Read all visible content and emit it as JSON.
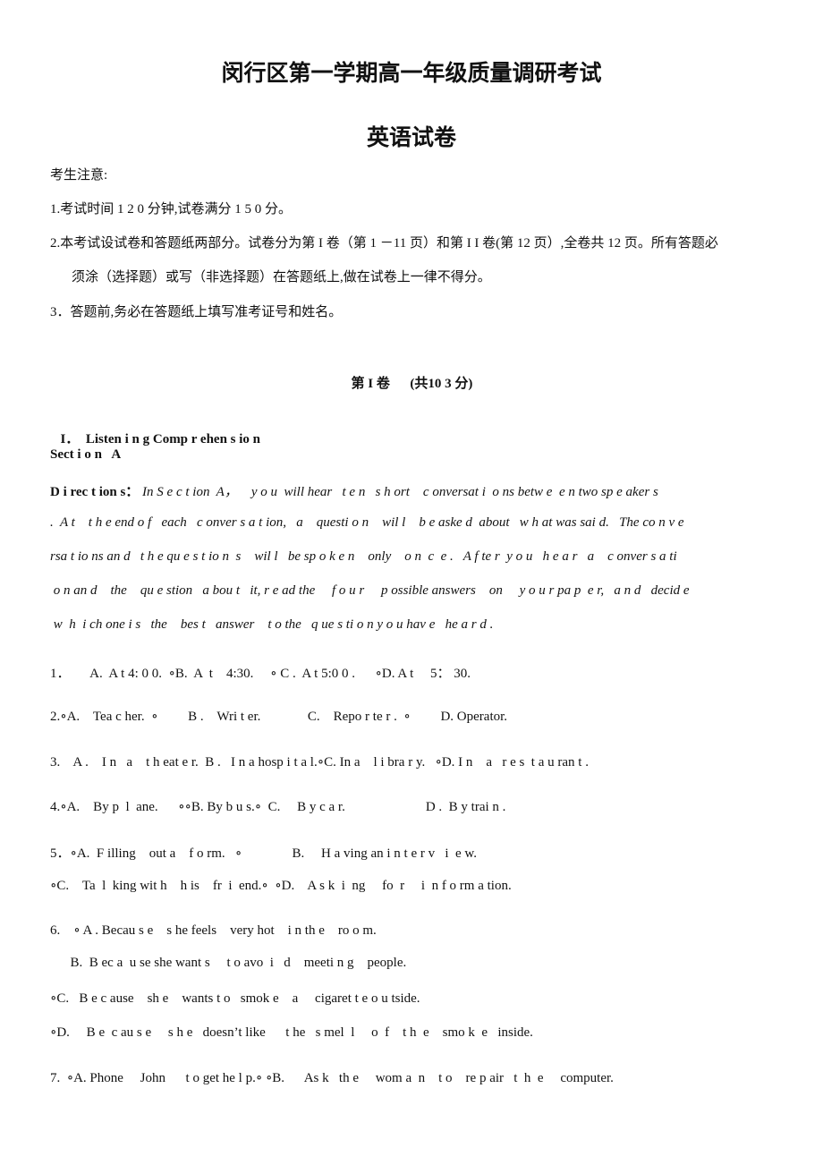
{
  "header": {
    "title": "闵行区第一学期高一年级质量调研考试",
    "subtitle": "英语试卷"
  },
  "notice": {
    "heading": "考生注意:",
    "items": [
      "1.考试时间 1 2 0 分钟,试卷满分 1 5 0 分。",
      "2.本考试设试卷和答题纸两部分。试卷分为第 I 卷（第 1 －11 页）和第 I I 卷(第 12 页）,全卷共 12 页。所有答题必",
      "须涂（选择题）或写（非选择题）在答题纸上,做在试卷上一律不得分。",
      "3．答题前,务必在答题纸上填写准考证号和姓名。"
    ]
  },
  "part": {
    "label": "第 I 卷",
    "score": "(共10 3 分)"
  },
  "section": {
    "roman": "I．",
    "title": "Listen i n g Comp r ehen s io n",
    "sub": "Sect i o n   A"
  },
  "directions": {
    "label": "D i rec t ion s：",
    "lines": [
      "In S e c t ion  A，    y o u  will hear   t e n   s h ort    c onversat i  o ns betw e  e n two sp e aker s",
      ".  A t    t h e end o f   each   c onver s a t ion,   a    questi o n    wil l    b e aske d  about   w h at was sai d.   The co n v e",
      "rsa t io ns an d   t h e qu e s t io n  s    wil l   be sp o k e n    only    o n  c  e .   A f te r  y o u   h e a r   a    c onver s a ti",
      " o n an d    the    qu e stion   a bou t   it, r e ad the     f o u r     p ossible answers    on     y o u r pa p  e r,   a n d   decid e",
      " w  h  i ch one i s   the    bes t   answer    t o the   q ue s ti o n y o u hav e   he a r d ."
    ]
  },
  "questions": [
    {
      "lines": [
        "1．      A.  A t 4: 0 0.  ∘B.  A  t    4:30.     ∘ C .  A t 5:0 0 .      ∘D. A t     5： 30."
      ]
    },
    {
      "lines": [
        "2.∘A.    Tea c her.  ∘         B .    Wri t er.              C.    Repo r te r .  ∘         D. Operator."
      ]
    },
    {
      "lines": [
        "3.    A .    I n   a    t h eat e r.  B .   I n a hosp i t a l.∘C. In a    l i bra r y.   ∘D. I n    a   r e s  t a u ran t ."
      ]
    },
    {
      "lines": [
        "4.∘A.    By p  l  ane.      ∘∘B. By b u s.∘  C.     B y c a r.                        D .  B y trai n ."
      ]
    },
    {
      "lines": [
        "5．∘A.  F illing    out a    f o rm.   ∘               B.     H a ving an i n t e r v   i  e w.",
        "∘C.    Ta  l  king wit h    h is    fr  i  end.∘  ∘D.    A s k  i  ng     fo  r     i  n f o rm a tion."
      ]
    },
    {
      "lines": [
        "6.    ∘ A . Becau s e    s he feels    very hot    i n th e    ro o m.",
        "      B.  B ec a  u se she want s     t o avo  i   d    meeti n g    people.",
        "∘C.   B e c ause    sh e    wants t o   smok e    a     cigaret t e o u tside.",
        "∘D.     B e  c au s e     s h e   doesn’t like      t he   s mel  l     o  f    t h  e    smo k  e   inside."
      ]
    },
    {
      "lines": [
        "7.  ∘A. Phone     John      t o get he l p.∘ ∘B.      As k   th e     wom a  n    t o    re p air   t  h  e     computer."
      ]
    }
  ]
}
